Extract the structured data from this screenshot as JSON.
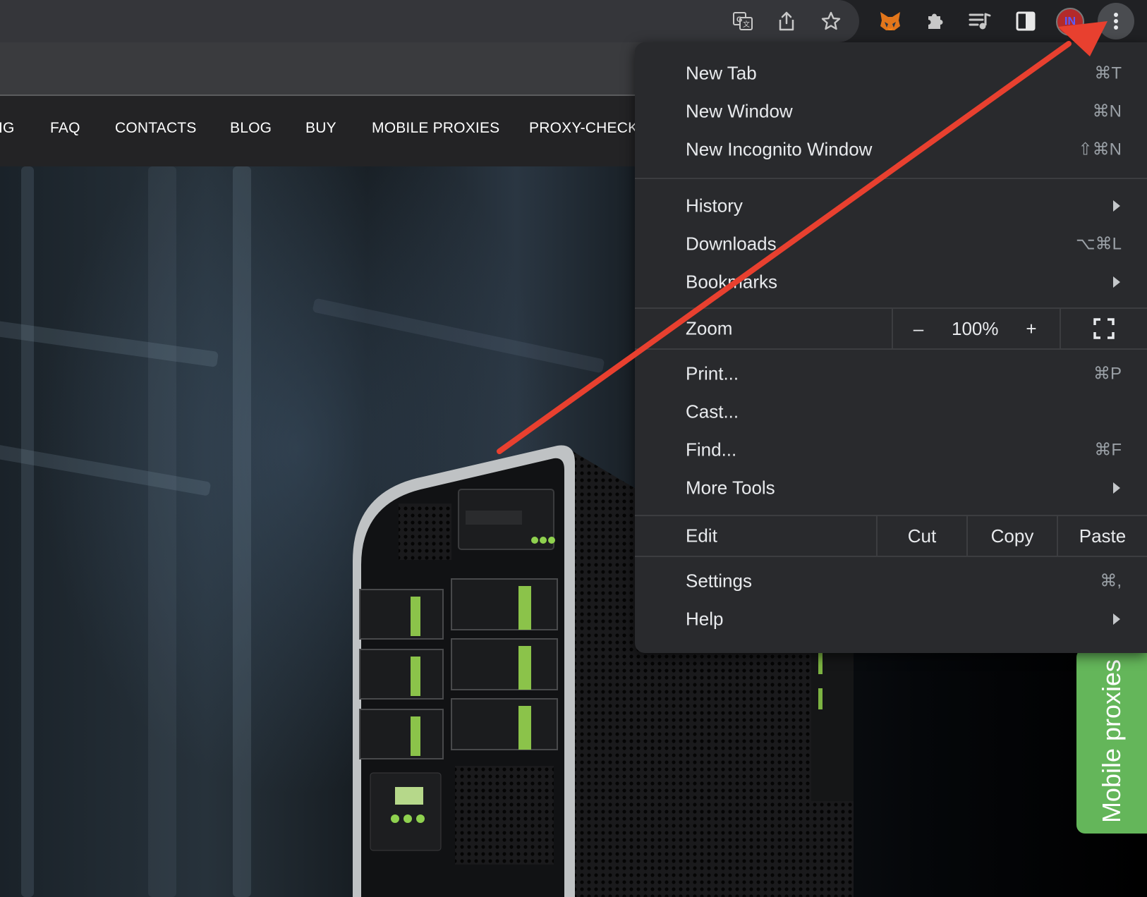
{
  "site": {
    "nav": [
      "IG",
      "FAQ",
      "CONTACTS",
      "BLOG",
      "BUY",
      "MOBILE PROXIES",
      "PROXY-CHECKI"
    ],
    "side_tab": "Mobile proxies"
  },
  "toolbar": {
    "avatar_text": "IN"
  },
  "menu": {
    "items": [
      {
        "label": "New Tab",
        "shortcut": "⌘T"
      },
      {
        "label": "New Window",
        "shortcut": "⌘N"
      },
      {
        "label": "New Incognito Window",
        "shortcut": "⇧⌘N"
      },
      {
        "label": "History",
        "submenu": true
      },
      {
        "label": "Downloads",
        "shortcut": "⌥⌘L"
      },
      {
        "label": "Bookmarks",
        "submenu": true
      },
      {
        "label": "Print...",
        "shortcut": "⌘P"
      },
      {
        "label": "Cast..."
      },
      {
        "label": "Find...",
        "shortcut": "⌘F"
      },
      {
        "label": "More Tools",
        "submenu": true
      },
      {
        "label": "Settings",
        "shortcut": "⌘,"
      },
      {
        "label": "Help",
        "submenu": true
      }
    ],
    "zoom": {
      "label": "Zoom",
      "minus": "–",
      "value": "100%",
      "plus": "+"
    },
    "edit": {
      "label": "Edit",
      "cut": "Cut",
      "copy": "Copy",
      "paste": "Paste"
    }
  },
  "colors": {
    "annotation_arrow": "#e8402f",
    "side_tab": "#64b65a",
    "menu_bg": "#292a2d"
  }
}
